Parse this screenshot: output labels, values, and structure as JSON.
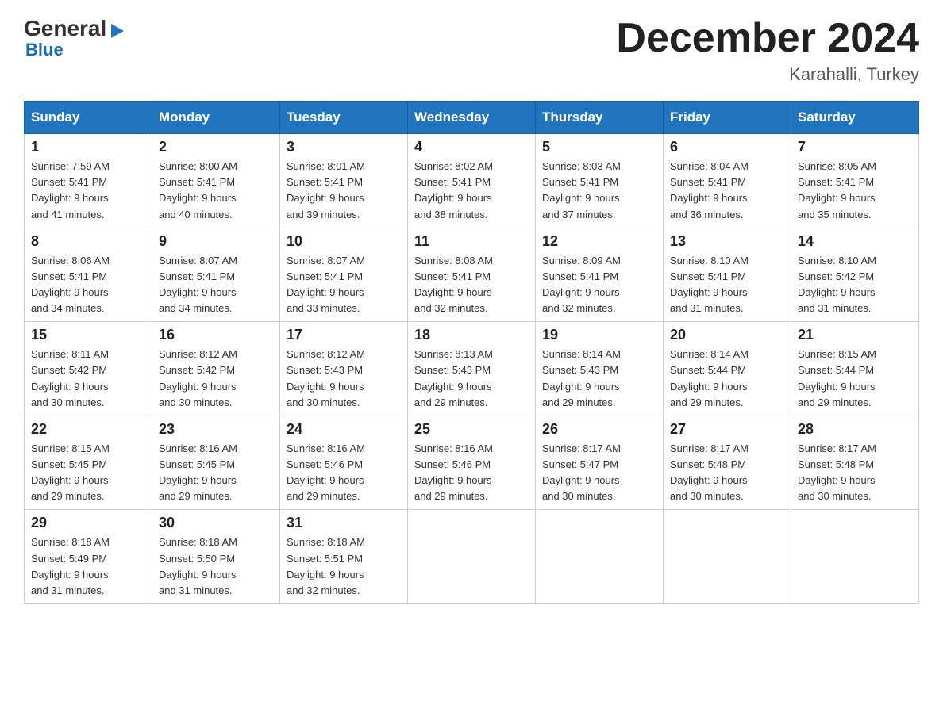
{
  "header": {
    "logo_general": "General",
    "logo_blue": "Blue",
    "month_title": "December 2024",
    "location": "Karahalli, Turkey"
  },
  "weekdays": [
    "Sunday",
    "Monday",
    "Tuesday",
    "Wednesday",
    "Thursday",
    "Friday",
    "Saturday"
  ],
  "weeks": [
    [
      {
        "day": "1",
        "sunrise": "7:59 AM",
        "sunset": "5:41 PM",
        "daylight": "9 hours and 41 minutes."
      },
      {
        "day": "2",
        "sunrise": "8:00 AM",
        "sunset": "5:41 PM",
        "daylight": "9 hours and 40 minutes."
      },
      {
        "day": "3",
        "sunrise": "8:01 AM",
        "sunset": "5:41 PM",
        "daylight": "9 hours and 39 minutes."
      },
      {
        "day": "4",
        "sunrise": "8:02 AM",
        "sunset": "5:41 PM",
        "daylight": "9 hours and 38 minutes."
      },
      {
        "day": "5",
        "sunrise": "8:03 AM",
        "sunset": "5:41 PM",
        "daylight": "9 hours and 37 minutes."
      },
      {
        "day": "6",
        "sunrise": "8:04 AM",
        "sunset": "5:41 PM",
        "daylight": "9 hours and 36 minutes."
      },
      {
        "day": "7",
        "sunrise": "8:05 AM",
        "sunset": "5:41 PM",
        "daylight": "9 hours and 35 minutes."
      }
    ],
    [
      {
        "day": "8",
        "sunrise": "8:06 AM",
        "sunset": "5:41 PM",
        "daylight": "9 hours and 34 minutes."
      },
      {
        "day": "9",
        "sunrise": "8:07 AM",
        "sunset": "5:41 PM",
        "daylight": "9 hours and 34 minutes."
      },
      {
        "day": "10",
        "sunrise": "8:07 AM",
        "sunset": "5:41 PM",
        "daylight": "9 hours and 33 minutes."
      },
      {
        "day": "11",
        "sunrise": "8:08 AM",
        "sunset": "5:41 PM",
        "daylight": "9 hours and 32 minutes."
      },
      {
        "day": "12",
        "sunrise": "8:09 AM",
        "sunset": "5:41 PM",
        "daylight": "9 hours and 32 minutes."
      },
      {
        "day": "13",
        "sunrise": "8:10 AM",
        "sunset": "5:41 PM",
        "daylight": "9 hours and 31 minutes."
      },
      {
        "day": "14",
        "sunrise": "8:10 AM",
        "sunset": "5:42 PM",
        "daylight": "9 hours and 31 minutes."
      }
    ],
    [
      {
        "day": "15",
        "sunrise": "8:11 AM",
        "sunset": "5:42 PM",
        "daylight": "9 hours and 30 minutes."
      },
      {
        "day": "16",
        "sunrise": "8:12 AM",
        "sunset": "5:42 PM",
        "daylight": "9 hours and 30 minutes."
      },
      {
        "day": "17",
        "sunrise": "8:12 AM",
        "sunset": "5:43 PM",
        "daylight": "9 hours and 30 minutes."
      },
      {
        "day": "18",
        "sunrise": "8:13 AM",
        "sunset": "5:43 PM",
        "daylight": "9 hours and 29 minutes."
      },
      {
        "day": "19",
        "sunrise": "8:14 AM",
        "sunset": "5:43 PM",
        "daylight": "9 hours and 29 minutes."
      },
      {
        "day": "20",
        "sunrise": "8:14 AM",
        "sunset": "5:44 PM",
        "daylight": "9 hours and 29 minutes."
      },
      {
        "day": "21",
        "sunrise": "8:15 AM",
        "sunset": "5:44 PM",
        "daylight": "9 hours and 29 minutes."
      }
    ],
    [
      {
        "day": "22",
        "sunrise": "8:15 AM",
        "sunset": "5:45 PM",
        "daylight": "9 hours and 29 minutes."
      },
      {
        "day": "23",
        "sunrise": "8:16 AM",
        "sunset": "5:45 PM",
        "daylight": "9 hours and 29 minutes."
      },
      {
        "day": "24",
        "sunrise": "8:16 AM",
        "sunset": "5:46 PM",
        "daylight": "9 hours and 29 minutes."
      },
      {
        "day": "25",
        "sunrise": "8:16 AM",
        "sunset": "5:46 PM",
        "daylight": "9 hours and 29 minutes."
      },
      {
        "day": "26",
        "sunrise": "8:17 AM",
        "sunset": "5:47 PM",
        "daylight": "9 hours and 30 minutes."
      },
      {
        "day": "27",
        "sunrise": "8:17 AM",
        "sunset": "5:48 PM",
        "daylight": "9 hours and 30 minutes."
      },
      {
        "day": "28",
        "sunrise": "8:17 AM",
        "sunset": "5:48 PM",
        "daylight": "9 hours and 30 minutes."
      }
    ],
    [
      {
        "day": "29",
        "sunrise": "8:18 AM",
        "sunset": "5:49 PM",
        "daylight": "9 hours and 31 minutes."
      },
      {
        "day": "30",
        "sunrise": "8:18 AM",
        "sunset": "5:50 PM",
        "daylight": "9 hours and 31 minutes."
      },
      {
        "day": "31",
        "sunrise": "8:18 AM",
        "sunset": "5:51 PM",
        "daylight": "9 hours and 32 minutes."
      },
      null,
      null,
      null,
      null
    ]
  ],
  "labels": {
    "sunrise": "Sunrise:",
    "sunset": "Sunset:",
    "daylight": "Daylight:"
  }
}
